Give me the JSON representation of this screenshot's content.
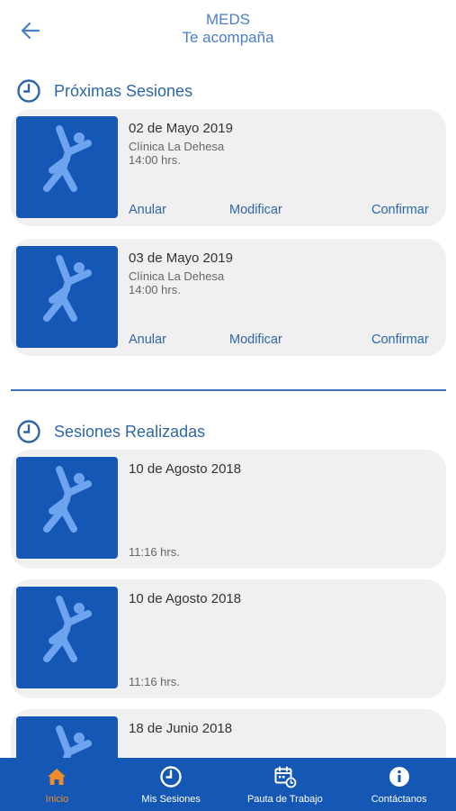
{
  "header": {
    "title": "MEDS",
    "subtitle": "Te acompaña",
    "back_icon": "arrow-left-icon"
  },
  "colors": {
    "accent": "#2e67a8",
    "tabbar": "#1557b4",
    "active_tab": "#f08c2a",
    "card_bg": "#f0f0f0"
  },
  "upcoming": {
    "title": "Próximas Sesiones",
    "sessions": [
      {
        "date": "02 de Mayo 2019",
        "place": "Clínica La Dehesa",
        "time": "14:00 hrs.",
        "cancel": "Anular",
        "modify": "Modificar",
        "confirm": "Confirmar"
      },
      {
        "date": "03 de Mayo 2019",
        "place": "Clínica La Dehesa",
        "time": "14:00 hrs.",
        "cancel": "Anular",
        "modify": "Modificar",
        "confirm": "Confirmar"
      }
    ]
  },
  "completed": {
    "title": "Sesiones Realizadas",
    "sessions": [
      {
        "date": "10 de Agosto 2018",
        "time": "11:16 hrs."
      },
      {
        "date": "10 de Agosto 2018",
        "time": "11:16 hrs."
      },
      {
        "date": "18 de Junio 2018"
      }
    ]
  },
  "tabs": [
    {
      "label": "Inicio",
      "icon": "home-icon",
      "active": true
    },
    {
      "label": "Mis Sesiones",
      "icon": "clock-icon",
      "active": false
    },
    {
      "label": "Pauta de Trabajo",
      "icon": "calendar-icon",
      "active": false
    },
    {
      "label": "Contáctanos",
      "icon": "info-icon",
      "active": false
    }
  ]
}
